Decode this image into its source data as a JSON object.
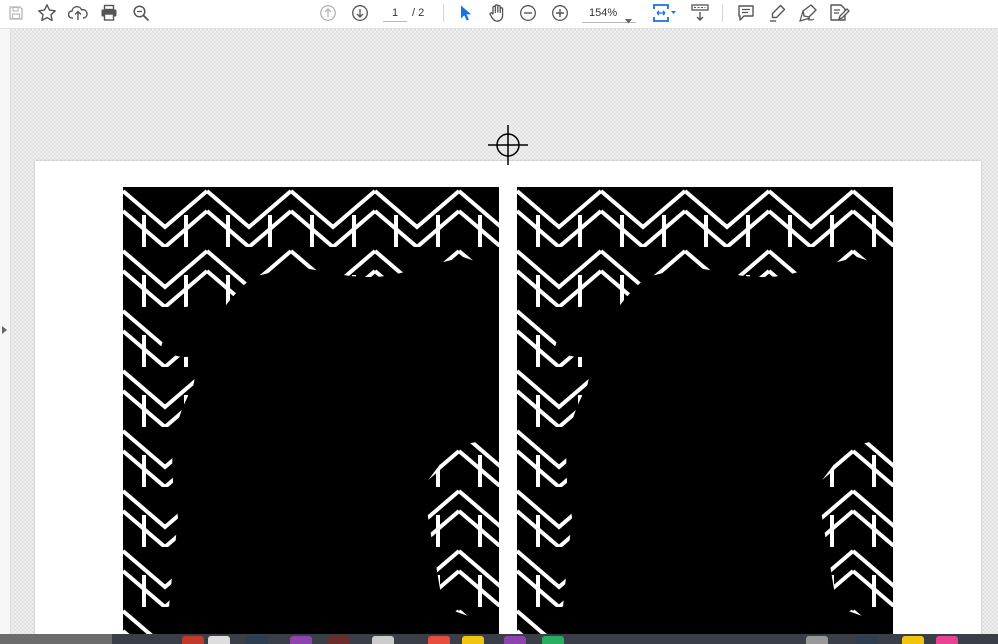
{
  "toolbar": {
    "current_page": "1",
    "total_pages": "/ 2",
    "zoom": "154%",
    "tools": [
      {
        "name": "save-icon"
      },
      {
        "name": "bookmark-star-icon"
      },
      {
        "name": "upload-cloud-icon"
      },
      {
        "name": "print-icon"
      },
      {
        "name": "zoom-search-icon"
      },
      {
        "name": "previous-page-icon"
      },
      {
        "name": "next-page-icon"
      },
      {
        "name": "select-pointer-icon"
      },
      {
        "name": "hand-tool-icon"
      },
      {
        "name": "zoom-out-icon"
      },
      {
        "name": "zoom-in-icon"
      },
      {
        "name": "fit-page-icon"
      },
      {
        "name": "scroll-mode-icon"
      },
      {
        "name": "comment-icon"
      },
      {
        "name": "highlight-pen-icon"
      },
      {
        "name": "sign-icon"
      },
      {
        "name": "fill-sign-icon"
      }
    ],
    "accent_color": "#1473e6"
  },
  "document": {
    "background_pattern": "checkerboard",
    "artwork_colors": [
      "#000000",
      "#ffffff"
    ]
  },
  "dock": {
    "app_colors": [
      "#c0392b",
      "#dddddd",
      "#2c3e50",
      "#8e44ad",
      "#6b2c2c",
      "#cccccc",
      "#e74c3c",
      "#f1c40f",
      "#8e44ad",
      "#27ae60",
      "#999999",
      "#2c3e50",
      "#f1c40f",
      "#e84393"
    ]
  }
}
